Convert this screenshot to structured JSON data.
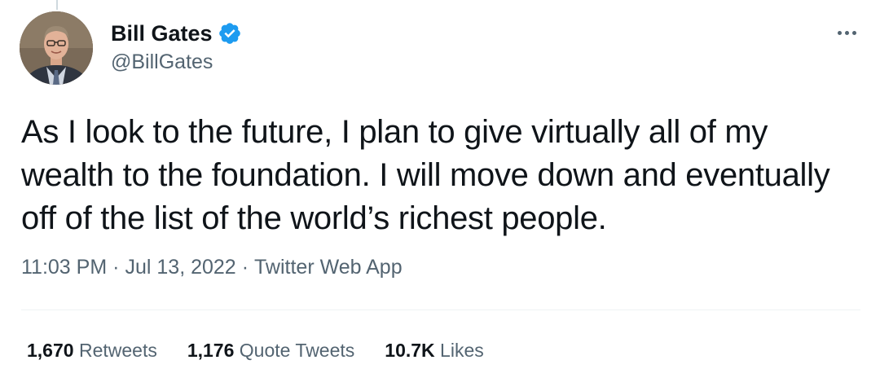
{
  "tweet": {
    "author": {
      "display_name": "Bill Gates",
      "handle": "@BillGates",
      "verified": true,
      "avatar_icon": "user-avatar"
    },
    "text": "As I look to the future, I plan to give virtually all of my wealth to the foundation. I will move down and eventually off of the list of the world’s richest people.",
    "meta": {
      "time": "11:03 PM",
      "separator": "·",
      "date": "Jul 13, 2022",
      "source": "Twitter Web App"
    },
    "stats": {
      "retweets_count": "1,670",
      "retweets_label": "Retweets",
      "quote_tweets_count": "1,176",
      "quote_tweets_label": "Quote Tweets",
      "likes_count": "10.7K",
      "likes_label": "Likes"
    }
  },
  "colors": {
    "text_primary": "#0f1419",
    "text_secondary": "#536471",
    "verified_blue": "#1d9bf0",
    "divider": "#eff3f4"
  },
  "icons": {
    "verified": "verified-badge-icon",
    "more": "more-horizontal-icon"
  }
}
